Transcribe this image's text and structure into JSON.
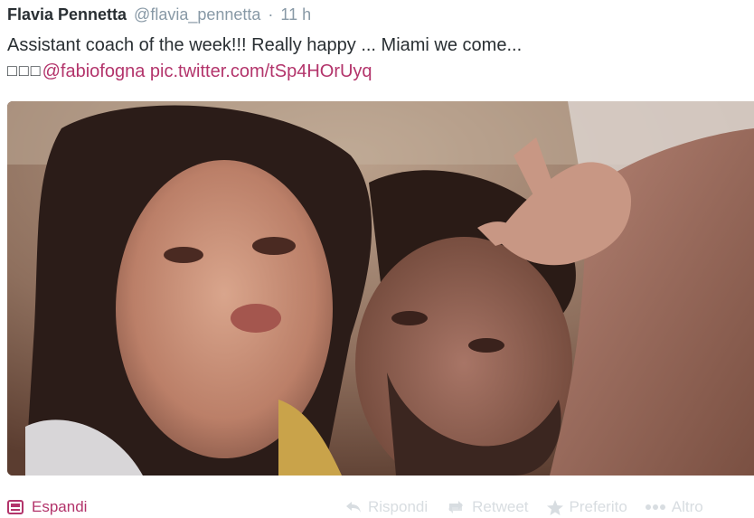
{
  "header": {
    "name": "Flavia Pennetta",
    "handle": "@flavia_pennetta",
    "separator": "·",
    "time": "11 h"
  },
  "body": {
    "line1": "Assistant coach of the week!!! Really happy ... Miami we come...",
    "glyphs": "□□□",
    "mention": "@fabiofogna",
    "pic_link": "pic.twitter.com/tSp4HOrUyq"
  },
  "photo": {
    "icon": "photo-image"
  },
  "footer": {
    "expand_label": "Espandi",
    "reply_label": "Rispondi",
    "retweet_label": "Retweet",
    "favorite_label": "Preferito",
    "more_label": "Altro"
  },
  "colors": {
    "link": "#b3346b",
    "name": "#292f33",
    "meta": "#8899a6",
    "faded_actions": "#d8dde1"
  }
}
